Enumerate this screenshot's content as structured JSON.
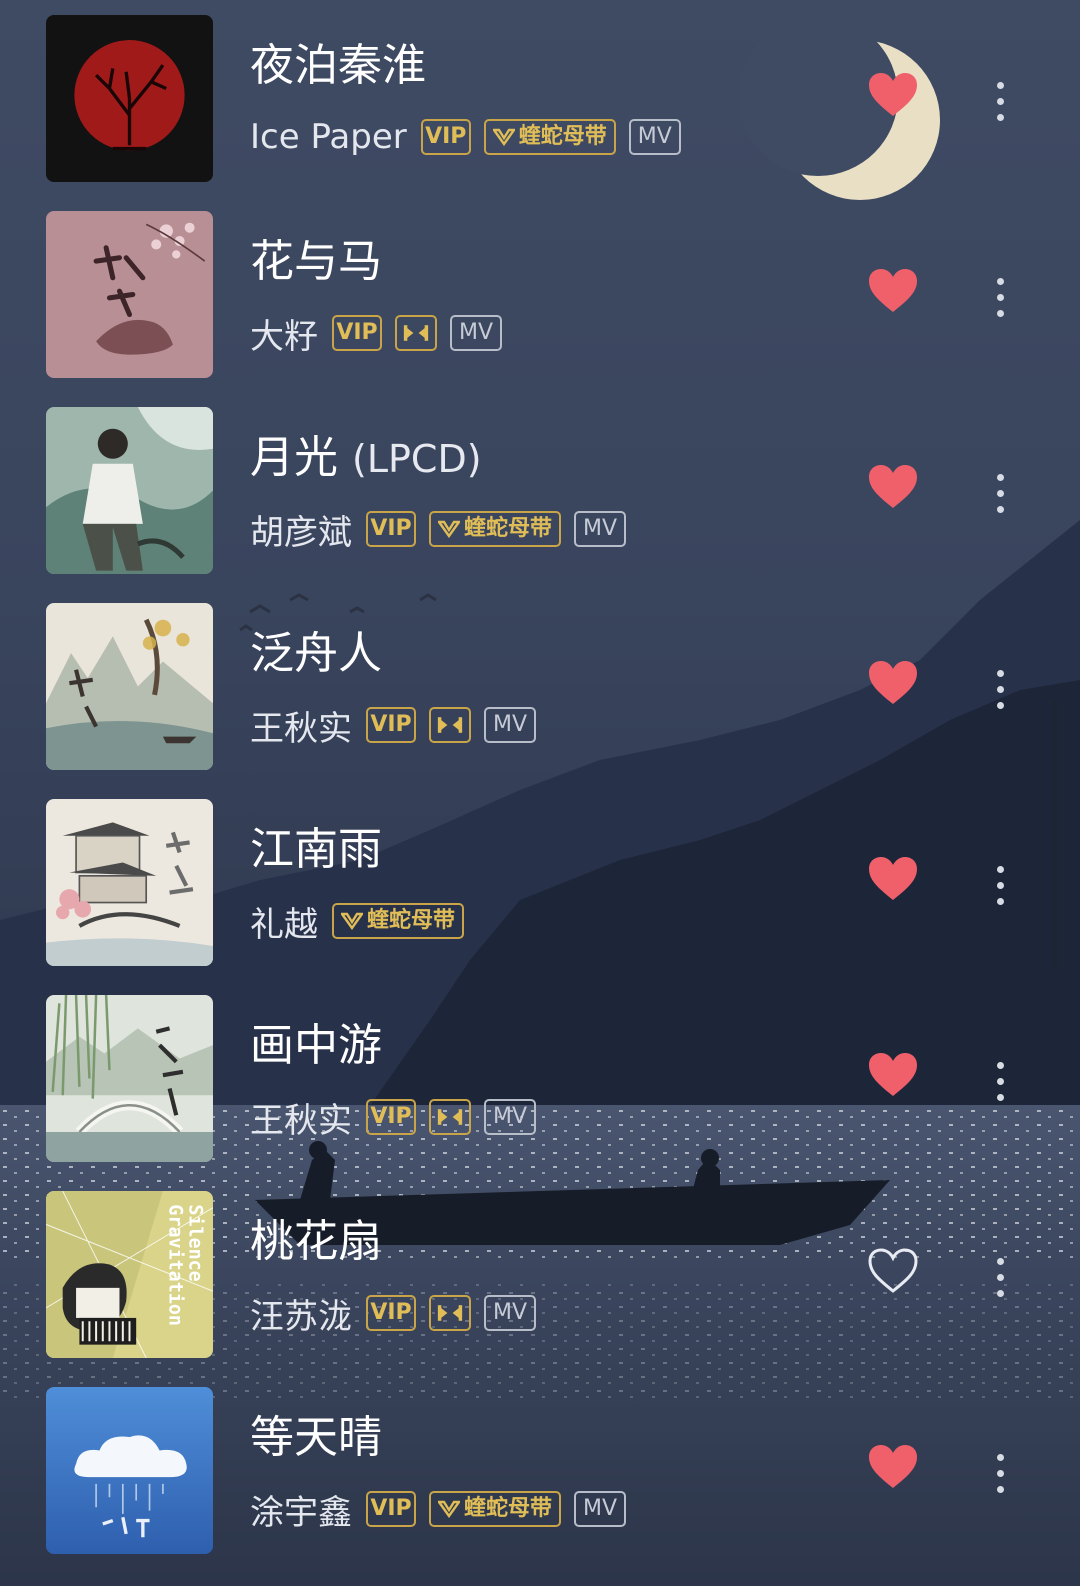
{
  "songs": [
    {
      "title": "夜泊秦淮",
      "title_suffix": "",
      "artist": "Ice Paper",
      "tags": [
        "VIP",
        "蝰蛇母带",
        "MV"
      ],
      "liked": true,
      "cover": "red-tree-circle"
    },
    {
      "title": "花与马",
      "title_suffix": "",
      "artist": "大籽",
      "tags": [
        "VIP",
        "SQ",
        "MV"
      ],
      "liked": true,
      "cover": "pink-calligraphy-horse"
    },
    {
      "title": "月光",
      "title_suffix": "(LPCD)",
      "artist": "胡彦斌",
      "tags": [
        "VIP",
        "蝰蛇母带",
        "MV"
      ],
      "liked": true,
      "cover": "man-portrait-green"
    },
    {
      "title": "泛舟人",
      "title_suffix": "",
      "artist": "王秋实",
      "tags": [
        "VIP",
        "SQ",
        "MV"
      ],
      "liked": true,
      "cover": "ink-landscape-boat"
    },
    {
      "title": "江南雨",
      "title_suffix": "",
      "artist": "礼越",
      "tags": [
        "蝰蛇母带"
      ],
      "liked": true,
      "cover": "pavilion-bridge"
    },
    {
      "title": "画中游",
      "title_suffix": "",
      "artist": "王秋实",
      "tags": [
        "VIP",
        "SQ",
        "MV"
      ],
      "liked": true,
      "cover": "willow-arch-bridge"
    },
    {
      "title": "桃花扇",
      "title_suffix": "",
      "artist": "汪苏泷",
      "tags": [
        "VIP",
        "SQ",
        "MV"
      ],
      "liked": false,
      "cover": "silence-gravitation"
    },
    {
      "title": "等天晴",
      "title_suffix": "",
      "artist": "涂宇鑫",
      "tags": [
        "VIP",
        "蝰蛇母带",
        "MV"
      ],
      "liked": true,
      "cover": "blue-sky-cloud"
    }
  ],
  "cover_text": {
    "silence_line1": "Silence",
    "silence_line2": "Gravitation"
  },
  "colors": {
    "heart_filled": "#f0606a",
    "tag_gold": "#e0bd57",
    "tag_gray": "#c6cbd6"
  },
  "icons": {
    "heart_filled": "heart-filled-icon",
    "heart_outline": "heart-outline-icon",
    "more": "more-vertical-icon",
    "sq": "sq-quality-icon",
    "viper": "viper-v-icon"
  }
}
